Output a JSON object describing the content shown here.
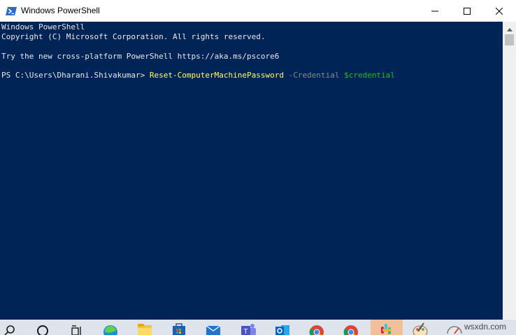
{
  "window": {
    "title": "Windows PowerShell",
    "icons": {
      "app": "powershell-icon",
      "minimize": "minimize-icon",
      "maximize": "maximize-icon",
      "close": "close-icon"
    }
  },
  "console": {
    "colors": {
      "background": "#012456",
      "text": "#e8e8e8",
      "command": "#ffff60",
      "parameter": "#8a8a8a",
      "variable": "#13c413"
    },
    "lines": [
      "Windows PowerShell",
      "Copyright (C) Microsoft Corporation. All rights reserved.",
      "Try the new cross-platform PowerShell https://aka.ms/pscore6"
    ],
    "prompt": {
      "path": "PS C:\\Users\\Dharani.Shivakumar> ",
      "command": "Reset-ComputerMachinePassword",
      "parameter": " -Credential ",
      "variable": "$credential"
    }
  },
  "taskbar": {
    "items": [
      {
        "icon": "search-icon"
      },
      {
        "icon": "cortana-icon"
      },
      {
        "icon": "task-view-icon"
      },
      {
        "icon": "edge-icon"
      },
      {
        "icon": "file-explorer-icon"
      },
      {
        "icon": "store-icon"
      },
      {
        "icon": "mail-icon"
      },
      {
        "icon": "teams-icon"
      },
      {
        "icon": "outlook-icon"
      },
      {
        "icon": "chrome-icon"
      },
      {
        "icon": "chrome-icon"
      },
      {
        "icon": "slack-icon"
      },
      {
        "icon": "paint-icon"
      },
      {
        "icon": "speedometer-icon"
      }
    ]
  },
  "watermark": "wsxdn.com"
}
